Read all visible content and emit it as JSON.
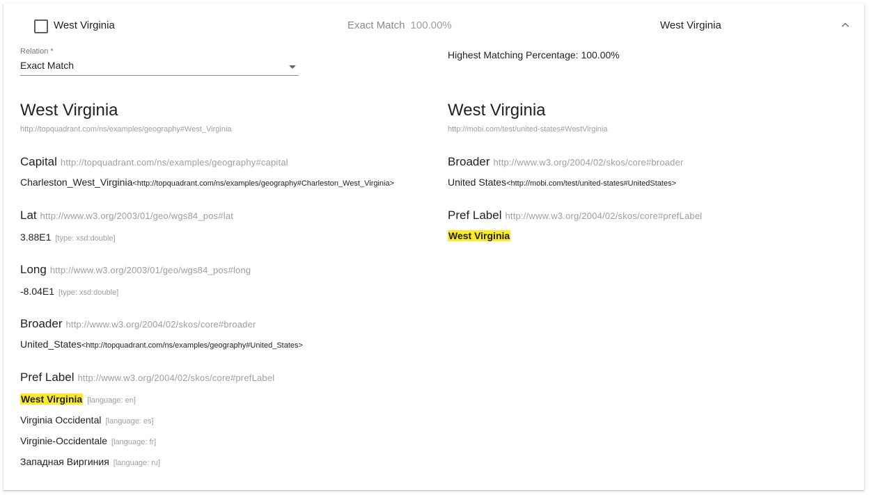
{
  "header": {
    "source_label": "West Virginia",
    "match_type": "Exact Match",
    "match_percent": "100.00%",
    "target_label": "West Virginia"
  },
  "relation": {
    "label": "Relation *",
    "value": "Exact Match"
  },
  "highest": "Highest Matching Percentage: 100.00%",
  "left": {
    "title": "West Virginia",
    "iri": "http://topquadrant.com/ns/examples/geography#West_Virginia",
    "props": {
      "capital": {
        "name": "Capital",
        "iri": "http://topquadrant.com/ns/examples/geography#capital",
        "values": [
          {
            "text": "Charleston_West_Virginia",
            "iri": "<http://topquadrant.com/ns/examples/geography#Charleston_West_Virginia>"
          }
        ]
      },
      "lat": {
        "name": "Lat",
        "iri": "http://www.w3.org/2003/01/geo/wgs84_pos#lat",
        "values": [
          {
            "text": "3.88E1",
            "tag": "[type: xsd:double]"
          }
        ]
      },
      "long": {
        "name": "Long",
        "iri": "http://www.w3.org/2003/01/geo/wgs84_pos#long",
        "values": [
          {
            "text": "-8.04E1",
            "tag": "[type: xsd:double]"
          }
        ]
      },
      "broader": {
        "name": "Broader",
        "iri": "http://www.w3.org/2004/02/skos/core#broader",
        "values": [
          {
            "text": "United_States",
            "iri": "<http://topquadrant.com/ns/examples/geography#United_States>"
          }
        ]
      },
      "pref": {
        "name": "Pref Label",
        "iri": "http://www.w3.org/2004/02/skos/core#prefLabel",
        "values": [
          {
            "text": "West Virginia",
            "tag": "[language: en]"
          },
          {
            "text": "Virginia Occidental",
            "tag": "[language: es]"
          },
          {
            "text": "Virginie-Occidentale",
            "tag": "[language: fr]"
          },
          {
            "text": "Западная Виргиния",
            "tag": "[language: ru]"
          }
        ]
      }
    }
  },
  "right": {
    "title": "West Virginia",
    "iri": "http://mobi.com/test/united-states#WestVirginia",
    "props": {
      "broader": {
        "name": "Broader",
        "iri": "http://www.w3.org/2004/02/skos/core#broader",
        "values": [
          {
            "text": "United States",
            "iri": "<http://mobi.com/test/united-states#UnitedStates>"
          }
        ]
      },
      "pref": {
        "name": "Pref Label",
        "iri": "http://www.w3.org/2004/02/skos/core#prefLabel",
        "values": [
          {
            "text": "West Virginia"
          }
        ]
      }
    }
  },
  "colors": {
    "highlight": "#fde92b",
    "muted": "#9e9e9e",
    "text": "#212121"
  }
}
